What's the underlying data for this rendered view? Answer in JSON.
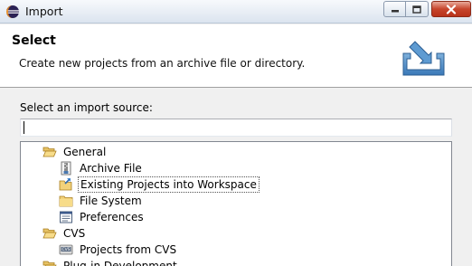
{
  "window": {
    "title": "Import",
    "app_icon": "eclipse-icon",
    "controls": {
      "minimize": "minimize-icon",
      "maximize": "maximize-icon",
      "close": "close-icon"
    }
  },
  "banner": {
    "title": "Select",
    "description": "Create new projects from an archive file or directory.",
    "icon": "import-wizard-icon"
  },
  "source": {
    "label": "Select an import source:",
    "filter_value": "",
    "tree": [
      {
        "label": "General",
        "icon": "folder-open-icon",
        "expanded": true,
        "children": [
          {
            "label": "Archive File",
            "icon": "archive-file-icon"
          },
          {
            "label": "Existing Projects into Workspace",
            "icon": "existing-project-icon",
            "selected": true
          },
          {
            "label": "File System",
            "icon": "folder-icon"
          },
          {
            "label": "Preferences",
            "icon": "preferences-icon"
          }
        ]
      },
      {
        "label": "CVS",
        "icon": "folder-open-icon",
        "expanded": true,
        "children": [
          {
            "label": "Projects from CVS",
            "icon": "cvs-icon"
          }
        ]
      },
      {
        "label": "Plug-in Development",
        "icon": "folder-open-icon",
        "expanded": true,
        "children": []
      }
    ]
  }
}
